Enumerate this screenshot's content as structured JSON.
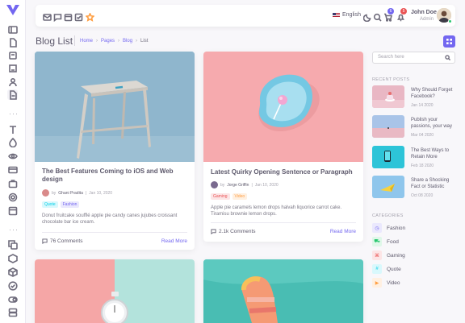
{
  "colors": {
    "primary": "#7367f0",
    "success": "#28c76f",
    "warning": "#ff9f43",
    "danger": "#ea5455",
    "info": "#00cfe8"
  },
  "navbar": {
    "language": "English",
    "cart_count": "6",
    "notif_count": "5",
    "user_name": "John Doe",
    "user_role": "Admin",
    "bookmark_icons": [
      "mail-icon",
      "chat-icon",
      "calendar-icon",
      "checkbox-icon",
      "star-icon"
    ]
  },
  "page": {
    "title": "Blog List"
  },
  "breadcrumbs": [
    "Home",
    "Pages",
    "Blog",
    "List"
  ],
  "posts": [
    {
      "title": "The Best Features Coming to iOS and Web design",
      "author_prefix": "by",
      "author": "Ghani Pradita",
      "date": "Jan 10, 2020",
      "tags": [
        "Quote",
        "Fashion"
      ],
      "excerpt": "Donut fruitcake soufflé apple pie candy canes jujubes croissant chocolate bar ice cream.",
      "comments": "76 Comments",
      "read_more": "Read More"
    },
    {
      "title": "Latest Quirky Opening Sentence or Paragraph",
      "author_prefix": "by",
      "author": "Jorge Griffin",
      "date": "Jan 10, 2020",
      "tags": [
        "Gaming",
        "Video"
      ],
      "excerpt": "Apple pie caramels lemon drops halvah liquorice carrot cake. Tiramisu brownie lemon drops.",
      "comments": "2.1k Comments",
      "read_more": "Read More"
    }
  ],
  "sidebar_right": {
    "search_placeholder": "Search here",
    "recent_label": "RECENT POSTS",
    "recent": [
      {
        "title": "Why Should Forget Facebook?",
        "date": "Jan 14 2020"
      },
      {
        "title": "Publish your passions, your way",
        "date": "Mar 04 2020"
      },
      {
        "title": "The Best Ways to Retain More",
        "date": "Feb 18 2020"
      },
      {
        "title": "Share a Shocking Fact or Statistic",
        "date": "Oct 08 2020"
      }
    ],
    "categories_label": "CATEGORIES",
    "categories": [
      {
        "name": "Fashion",
        "icon": "watch-icon"
      },
      {
        "name": "Food",
        "icon": "cart-icon"
      },
      {
        "name": "Gaming",
        "icon": "command-icon"
      },
      {
        "name": "Quote",
        "icon": "hash-icon"
      },
      {
        "name": "Video",
        "icon": "video-icon"
      }
    ]
  }
}
